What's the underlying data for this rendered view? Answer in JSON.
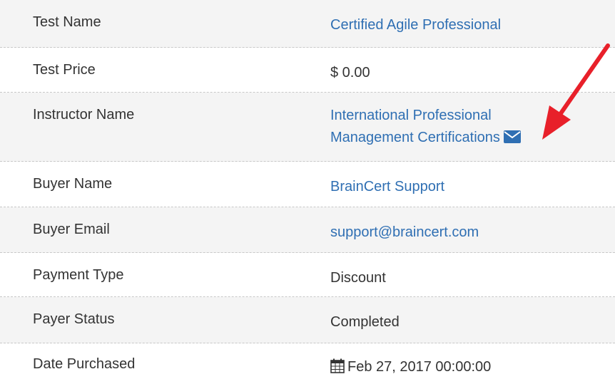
{
  "rows": [
    {
      "label": "Test Name",
      "value": "Certified Agile Professional",
      "type": "link"
    },
    {
      "label": "Test Price",
      "value": "$ 0.00",
      "type": "text"
    },
    {
      "label": "Instructor Name",
      "value_line1": "International Professional",
      "value_line2": "Management Certifications",
      "type": "link",
      "icon": "envelope-icon"
    },
    {
      "label": "Buyer Name",
      "value": "BrainCert Support",
      "type": "link"
    },
    {
      "label": "Buyer Email",
      "value": "support@braincert.com",
      "type": "link"
    },
    {
      "label": "Payment Type",
      "value": "Discount",
      "type": "text"
    },
    {
      "label": "Payer Status",
      "value": "Completed",
      "type": "text"
    },
    {
      "label": "Date Purchased",
      "value": "Feb 27, 2017 00:00:00",
      "type": "text",
      "icon": "calendar-icon"
    }
  ],
  "colors": {
    "link": "#2f6fb3",
    "text": "#333333",
    "stripe": "#f4f4f4",
    "arrow": "#e8202a"
  }
}
